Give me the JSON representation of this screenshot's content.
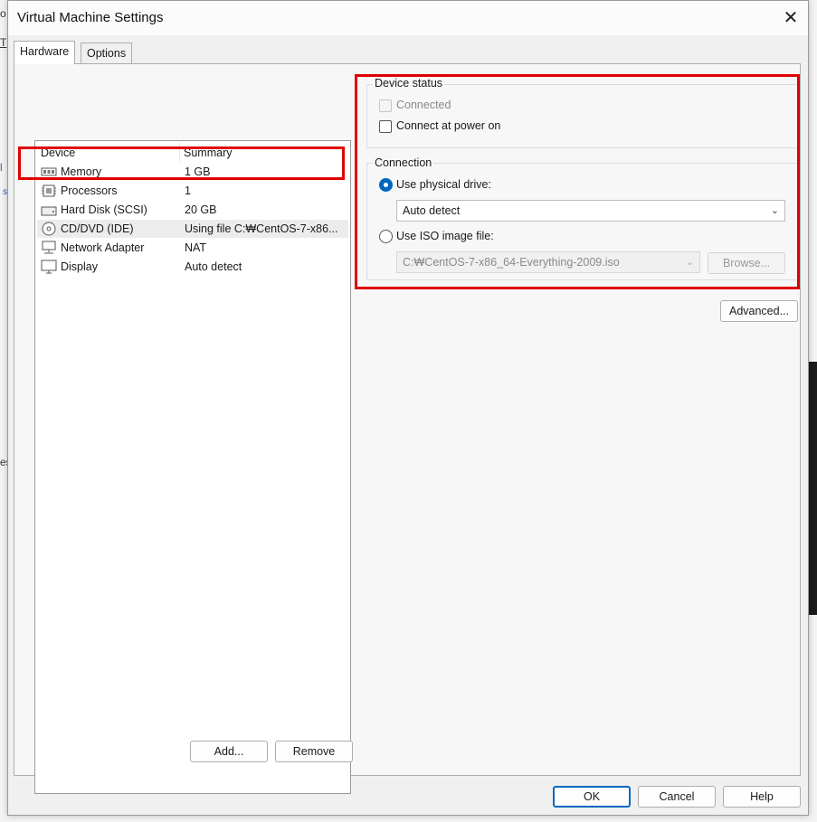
{
  "window": {
    "title": "Virtual Machine Settings",
    "close_glyph": "✕"
  },
  "tabs": [
    {
      "label": "Hardware"
    },
    {
      "label": "Options"
    }
  ],
  "device_list": {
    "headers": {
      "device": "Device",
      "summary": "Summary"
    },
    "rows": [
      {
        "device": "Memory",
        "summary": "1 GB",
        "icon": "memory-icon"
      },
      {
        "device": "Processors",
        "summary": "1",
        "icon": "processor-icon"
      },
      {
        "device": "Hard Disk (SCSI)",
        "summary": "20 GB",
        "icon": "hard-disk-icon"
      },
      {
        "device": "CD/DVD (IDE)",
        "summary": "Using file C:₩CentOS-7-x86...",
        "icon": "cd-dvd-icon",
        "selected": true
      },
      {
        "device": "Network Adapter",
        "summary": "NAT",
        "icon": "network-adapter-icon"
      },
      {
        "device": "Display",
        "summary": "Auto detect",
        "icon": "display-icon"
      }
    ],
    "add_label": "Add...",
    "remove_label": "Remove"
  },
  "device_status": {
    "title": "Device status",
    "connected": {
      "label": "Connected",
      "checked": false,
      "enabled": false
    },
    "connect_at_power_on": {
      "label": "Connect at power on",
      "checked": false
    }
  },
  "connection": {
    "title": "Connection",
    "physical": {
      "label": "Use physical drive:",
      "selected": true,
      "value": "Auto detect"
    },
    "iso": {
      "label": "Use ISO image file:",
      "selected": false,
      "value": "C:₩CentOS-7-x86_64-Everything-2009.iso",
      "browse_label": "Browse..."
    }
  },
  "advanced_label": "Advanced...",
  "footer": {
    "ok": "OK",
    "cancel": "Cancel",
    "help": "Help"
  },
  "background": {
    "frag_o": "o",
    "frag_t": "T",
    "frag_s1": "s",
    "frag_es": "es",
    "frag_l": "l"
  },
  "colors": {
    "highlight": "#e00000",
    "accent": "#0067c0"
  }
}
